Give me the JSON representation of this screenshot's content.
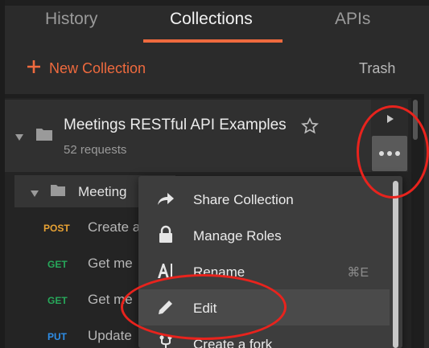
{
  "tabs": [
    {
      "label": "History"
    },
    {
      "label": "Collections"
    },
    {
      "label": "APIs"
    }
  ],
  "toolbar": {
    "new_collection": "New Collection",
    "trash": "Trash"
  },
  "collection": {
    "name": "Meetings RESTful API Examples",
    "count": "52 requests"
  },
  "folder": {
    "name": "Meeting"
  },
  "requests": [
    {
      "method": "POST",
      "color": "#e8a234",
      "name": "Create a"
    },
    {
      "method": "GET",
      "color": "#27a85a",
      "name": "Get me"
    },
    {
      "method": "GET",
      "color": "#27a85a",
      "name": "Get me"
    },
    {
      "method": "PUT",
      "color": "#2e8ee8",
      "name": "Update"
    }
  ],
  "menu": {
    "items": [
      {
        "label": "Share Collection",
        "icon": "share-icon"
      },
      {
        "label": "Manage Roles",
        "icon": "lock-icon"
      },
      {
        "label": "Rename",
        "icon": "rename-icon",
        "shortcut": "⌘E"
      },
      {
        "label": "Edit",
        "icon": "pencil-icon"
      },
      {
        "label": "Create a fork",
        "icon": "fork-icon"
      }
    ]
  },
  "colors": {
    "accent": "#ef6a3e",
    "annotation": "#e8231d"
  }
}
